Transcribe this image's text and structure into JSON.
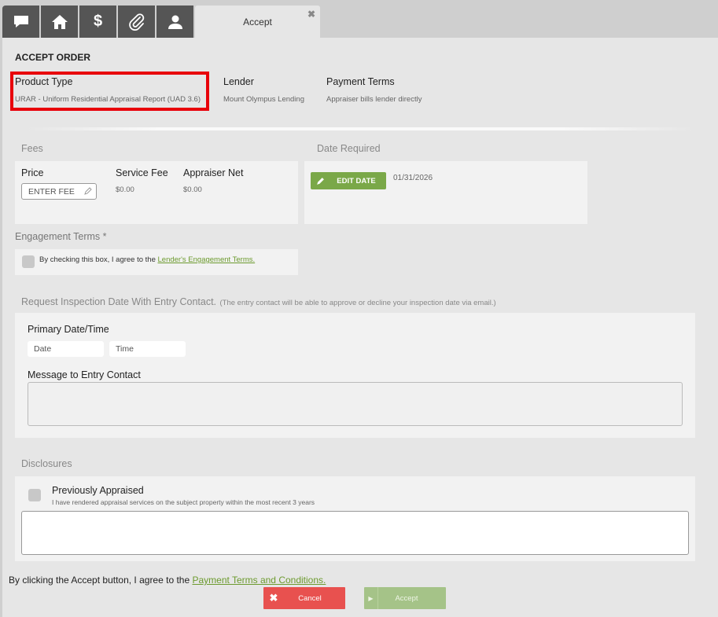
{
  "tabs": {
    "icons": [
      "chat-icon",
      "home-icon",
      "dollar-icon",
      "paperclip-icon",
      "user-icon"
    ],
    "active_label": "Accept",
    "close_label": "✖"
  },
  "accept_order": {
    "heading": "ACCEPT ORDER",
    "product_type_label": "Product Type",
    "product_type_value": "URAR - Uniform Residential Appraisal Report (UAD 3.6)",
    "lender_label": "Lender",
    "lender_value": "Mount Olympus Lending",
    "payment_terms_label": "Payment Terms",
    "payment_terms_value": "Appraiser bills lender directly"
  },
  "fees": {
    "title": "Fees",
    "price_label": "Price",
    "price_placeholder": "ENTER FEE",
    "service_fee_label": "Service Fee",
    "service_fee_value": "$0.00",
    "appraiser_net_label": "Appraiser Net",
    "appraiser_net_value": "$0.00"
  },
  "date_required": {
    "title": "Date Required",
    "edit_label": "EDIT DATE",
    "value": "01/31/2026"
  },
  "engagement": {
    "title": "Engagement Terms *",
    "text": "By checking this box, I agree to the",
    "link": "Lender's Engagement Terms."
  },
  "inspection": {
    "title": "Request Inspection Date With Entry Contact.",
    "note": "(The entry contact will be able to approve or decline your inspection date via email.)",
    "primary_label": "Primary Date/Time",
    "date_placeholder": "Date",
    "time_placeholder": "Time",
    "message_label": "Message to Entry Contact"
  },
  "disclosures": {
    "title": "Disclosures",
    "prev_title": "Previously Appraised",
    "prev_text": "I have rendered appraisal services on the subject property within the most recent 3 years"
  },
  "footer": {
    "text": "By clicking the Accept button, I agree to the",
    "link": "Payment Terms and Conditions.",
    "cancel_label": "Cancel",
    "accept_label": "Accept"
  },
  "colors": {
    "highlight": "#e8000a",
    "green": "#7aa848",
    "red": "#e8514f",
    "tab_dark": "#555555"
  }
}
